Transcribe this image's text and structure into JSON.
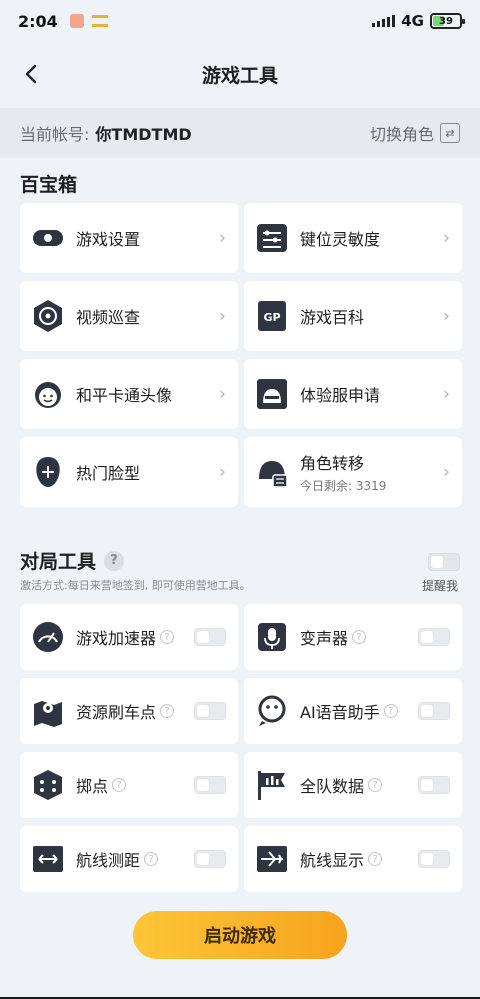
{
  "status": {
    "time": "2:04",
    "network": "4G",
    "battery": "39"
  },
  "header": {
    "title": "游戏工具"
  },
  "account": {
    "label": "当前帐号:",
    "name": "你TMDTMD",
    "switch_label": "切换角色"
  },
  "treasure_box": {
    "title": "百宝箱",
    "items": [
      {
        "label": "游戏设置",
        "icon": "gear-icon"
      },
      {
        "label": "键位灵敏度",
        "icon": "sliders-icon"
      },
      {
        "label": "视频巡查",
        "icon": "target-icon"
      },
      {
        "label": "游戏百科",
        "icon": "gp-book-icon"
      },
      {
        "label": "和平卡通头像",
        "icon": "cartoon-face-icon"
      },
      {
        "label": "体验服申请",
        "icon": "beta-helmet-icon"
      },
      {
        "label": "热门脸型",
        "icon": "face-shape-icon"
      },
      {
        "label": "角色转移",
        "sub": "今日剩余: 3319",
        "icon": "role-transfer-icon"
      }
    ]
  },
  "battle_tools": {
    "title": "对局工具",
    "help": "?",
    "activation_text": "激活方式:每日来营地签到, 即可使用营地工具。",
    "remind_label": "提醒我",
    "items": [
      {
        "label": "游戏加速器",
        "icon": "speedometer-icon",
        "help": "?"
      },
      {
        "label": "变声器",
        "icon": "microphone-icon",
        "help": "?"
      },
      {
        "label": "资源刷车点",
        "icon": "map-pin-icon",
        "help": "?"
      },
      {
        "label": "AI语音助手",
        "icon": "ai-voice-icon",
        "help": "?"
      },
      {
        "label": "掷点",
        "icon": "dice-icon",
        "help": "?"
      },
      {
        "label": "全队数据",
        "icon": "team-stats-icon",
        "help": "?"
      },
      {
        "label": "航线测距",
        "icon": "route-measure-icon",
        "help": "?"
      },
      {
        "label": "航线显示",
        "icon": "plane-route-icon",
        "help": "?"
      }
    ]
  },
  "start_button": {
    "label": "启动游戏"
  }
}
